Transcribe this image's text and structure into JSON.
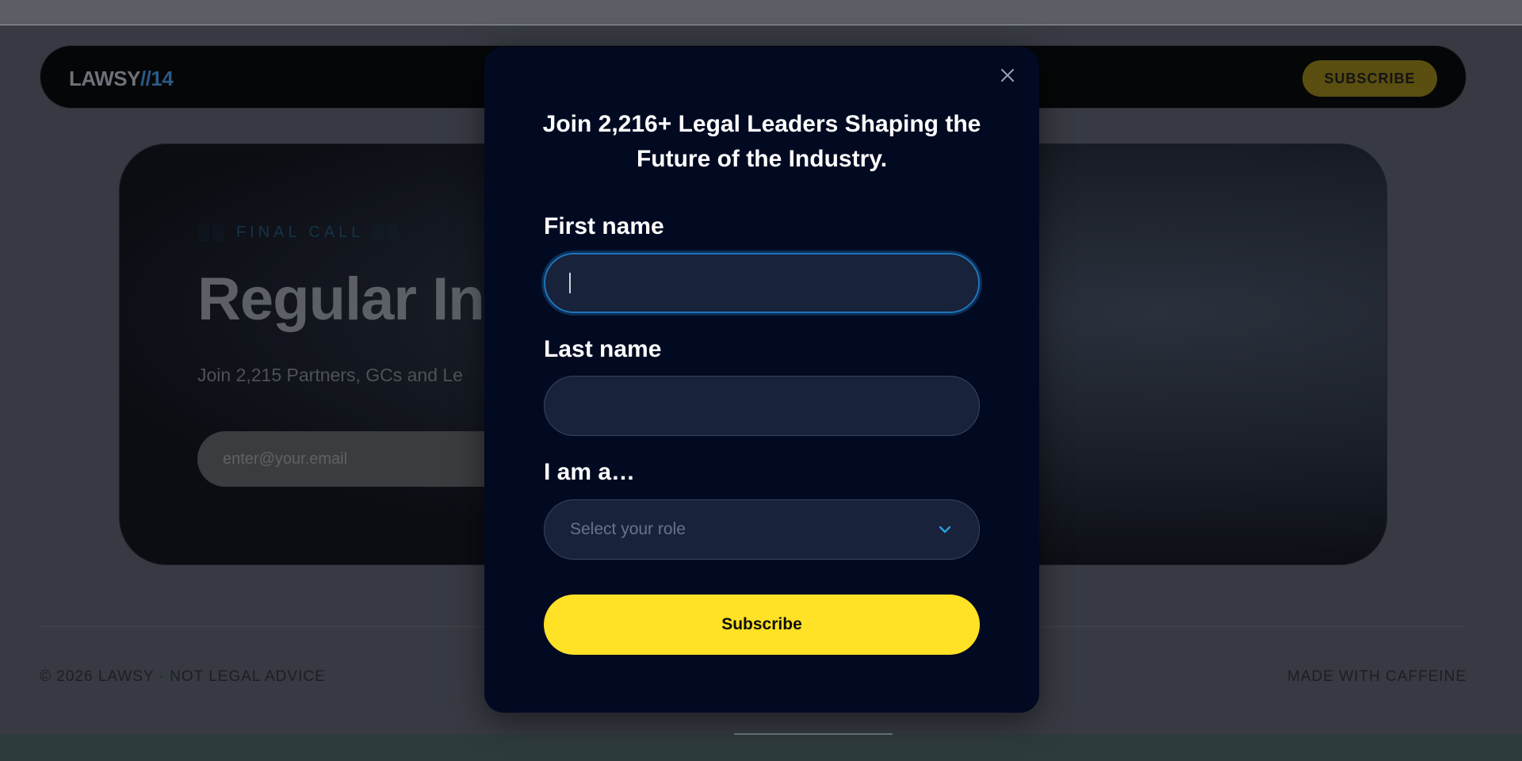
{
  "site": {
    "logo_main": "LAWSY",
    "logo_accent": "//14",
    "nav_subscribe_label": "SUBSCRIBE"
  },
  "hero": {
    "kicker": "░░ FINAL CALL ░░",
    "title": "Regular Ins",
    "subtitle": "Join 2,215 Partners, GCs and Le",
    "email_placeholder": "enter@your.email"
  },
  "footer": {
    "left": "© 2026 LAWSY · NOT LEGAL ADVICE",
    "right": "MADE WITH CAFFEINE"
  },
  "modal": {
    "title": "Join 2,216+ Legal Leaders Shaping the Future of the Industry.",
    "first_name_label": "First name",
    "first_name_value": "",
    "last_name_label": "Last name",
    "last_name_value": "",
    "role_label": "I am a…",
    "role_placeholder": "Select your role",
    "submit_label": "Subscribe",
    "close_icon": "close-icon",
    "chevron_icon": "chevron-down-icon"
  },
  "colors": {
    "modal_bg": "#020a22",
    "accent_yellow": "#ffe125",
    "focus_blue": "#1f73b7",
    "chevron_blue": "#2a9fe0"
  }
}
